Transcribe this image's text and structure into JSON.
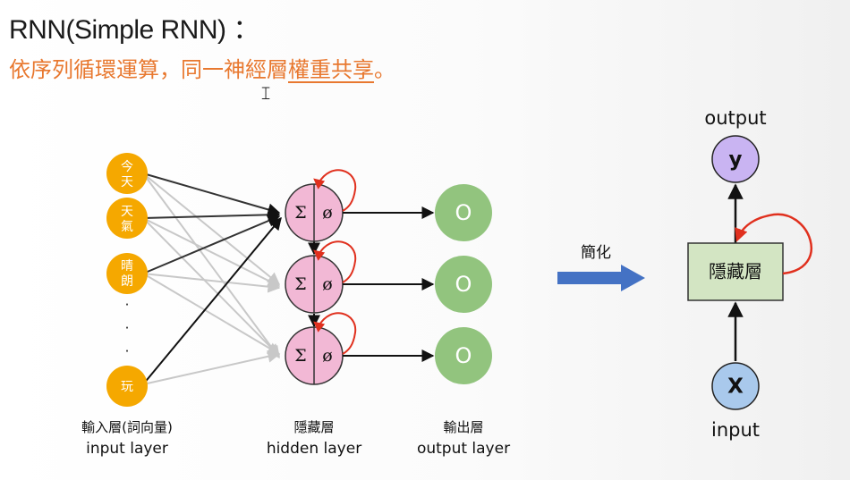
{
  "title": "RNN(Simple RNN) ：",
  "subtitle": {
    "prefix": "依序列循環運算，同一神經層",
    "emphasis": "權重共享",
    "suffix": "。"
  },
  "input_nodes": [
    {
      "chars": [
        "今",
        "天"
      ]
    },
    {
      "chars": [
        "天",
        "氣"
      ]
    },
    {
      "chars": [
        "晴",
        "朗"
      ]
    },
    {
      "chars": [
        "玩"
      ]
    }
  ],
  "ellipsis": "·",
  "hidden_symbols": {
    "sum": "Σ",
    "activation": "ø"
  },
  "output_symbol": "O",
  "labels": {
    "input_zh": "輸入層(詞向量)",
    "input_en": "input layer",
    "hidden_zh": "隱藏層",
    "hidden_en": "hidden layer",
    "output_zh": "輸出層",
    "output_en": "output layer"
  },
  "simplify_label": "簡化",
  "simplified": {
    "output_label": "output",
    "y": "y",
    "box": "隱藏層",
    "x": "X",
    "input_label": "input"
  },
  "colors": {
    "input_node": "#f5a800",
    "hidden_node": "#f2b8d5",
    "output_node": "#92c47e",
    "simple_circle": "#c9b4f2",
    "simple_input": "#a9c9ec",
    "simple_box": "#d3e5c3",
    "arrow_blue": "#4472c4",
    "recur_red": "#e0301e",
    "subtitle": "#e8782f"
  }
}
